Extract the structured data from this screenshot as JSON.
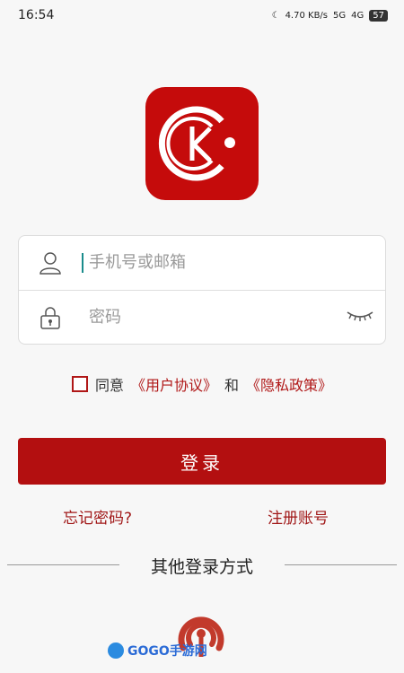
{
  "status_bar": {
    "time": "16:54",
    "speed": "4.70 KB/s",
    "signal_a": "5G",
    "signal_b": "4G",
    "battery": "57"
  },
  "login": {
    "account_placeholder": "手机号或邮箱",
    "password_placeholder": "密码"
  },
  "agreement": {
    "prefix": "同意",
    "user_agreement": "《用户协议》",
    "and": "和",
    "privacy_policy": "《隐私政策》"
  },
  "buttons": {
    "login": "登录",
    "forgot_password": "忘记密码?",
    "register": "注册账号"
  },
  "other_login": {
    "title": "其他登录方式"
  },
  "watermark": {
    "text": "GOGO手游网"
  },
  "colors": {
    "primary": "#b30f10",
    "logo_bg": "#c50b0b"
  },
  "icons": {
    "user": "user-icon",
    "lock": "lock-icon",
    "eye": "eye-closed-icon",
    "social": "signal-icon"
  }
}
